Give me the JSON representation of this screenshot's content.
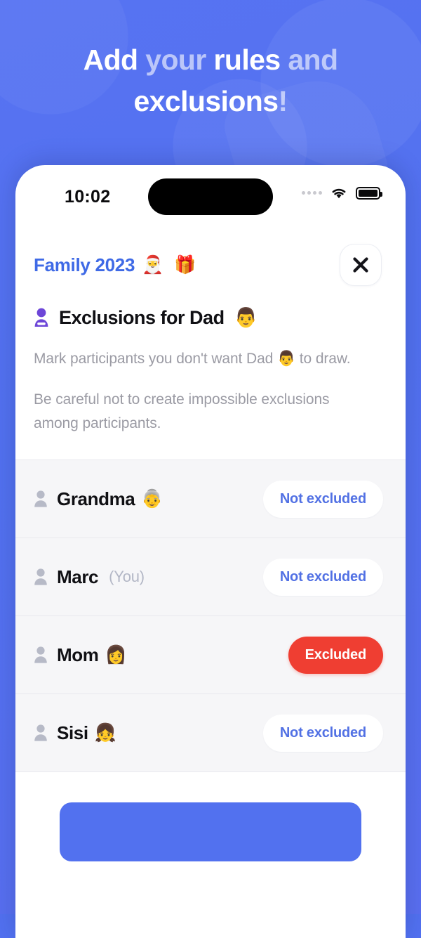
{
  "promo": {
    "headline_parts": [
      {
        "text": "Add ",
        "dim": false
      },
      {
        "text": "your ",
        "dim": true
      },
      {
        "text": "rules ",
        "dim": false
      },
      {
        "text": "and",
        "dim": true
      },
      {
        "text": " exclusions",
        "dim": false
      },
      {
        "text": "!",
        "dim": true
      }
    ],
    "headline_plain": "Add your rules and exclusions!",
    "background_color": "#5271f0"
  },
  "status_bar": {
    "time": "10:02",
    "signal_icon": "signal-dots-icon",
    "wifi_icon": "wifi-icon",
    "battery_icon": "battery-full-icon"
  },
  "app_header": {
    "group_name": "Family 2023",
    "group_emoji": "🎅 🎁",
    "close_icon": "close-icon"
  },
  "intro": {
    "icon": "person-minus-icon",
    "title": "Exclusions for Dad",
    "title_emoji": "👨",
    "paragraph_1": "Mark participants you don't want Dad 👨 to draw.",
    "paragraph_2": "Be careful not to create impossible exclusions among participants."
  },
  "participants": {
    "status_labels": {
      "not_excluded": "Not excluded",
      "excluded": "Excluded"
    },
    "rows": [
      {
        "name": "Grandma",
        "emoji": "👵",
        "you_tag": "",
        "status": "Not excluded",
        "excluded": false
      },
      {
        "name": "Marc",
        "emoji": "",
        "you_tag": "(You)",
        "status": "Not excluded",
        "excluded": false
      },
      {
        "name": "Mom",
        "emoji": "👩",
        "you_tag": "",
        "status": "Excluded",
        "excluded": true
      },
      {
        "name": "Sisi",
        "emoji": "👧",
        "you_tag": "",
        "status": "Not excluded",
        "excluded": false
      }
    ]
  },
  "footer": {
    "primary_button_label": "",
    "primary_button_color": "#5271ef"
  },
  "colors": {
    "brand_blue": "#5271f0",
    "title_blue": "#3f6ae6",
    "pill_blue": "#5271e4",
    "excluded_red": "#ef3e32",
    "icon_purple": "#6d46d8",
    "muted_gray": "#9b9ba4",
    "row_bg": "#f6f6f8"
  }
}
